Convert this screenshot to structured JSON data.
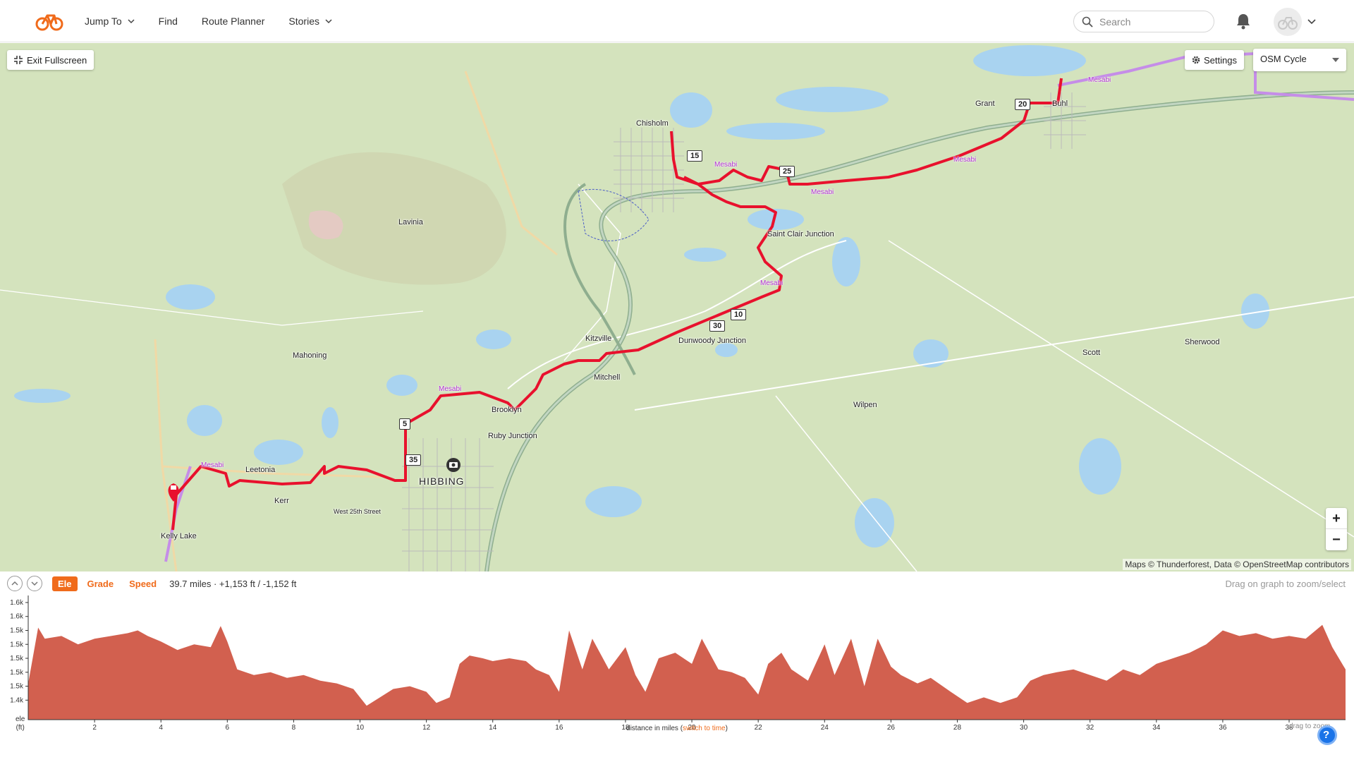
{
  "header": {
    "nav": [
      {
        "label": "Jump To",
        "has_menu": true
      },
      {
        "label": "Find",
        "has_menu": false
      },
      {
        "label": "Route Planner",
        "has_menu": false
      },
      {
        "label": "Stories",
        "has_menu": true
      }
    ],
    "search_placeholder": "Search",
    "brand_color": "#f06b1b"
  },
  "map": {
    "exit_fullscreen_label": "Exit Fullscreen",
    "settings_label": "Settings",
    "layer_selected": "OSM Cycle",
    "zoom_in": "+",
    "zoom_out": "−",
    "attribution": "Maps © Thunderforest, Data © OpenStreetMap contributors",
    "route_color": "#e8112d",
    "places": [
      "Chisholm",
      "Grant",
      "Buhl",
      "Lavinia",
      "Saint Clair Junction",
      "Kitzville",
      "Dunwoody Junction",
      "Mahoning",
      "Mitchell",
      "Scott",
      "Sherwood",
      "Wilpen",
      "Brooklyn",
      "Ruby Junction",
      "HIBBING",
      "Leetonia",
      "Kerr",
      "Kelly Lake",
      "West 25th Street"
    ],
    "trail_label": "Mesabi",
    "mile_markers": [
      "5",
      "10",
      "15",
      "20",
      "25",
      "30",
      "35"
    ]
  },
  "elevation_panel": {
    "tabs": [
      "Ele",
      "Grade",
      "Speed"
    ],
    "active_tab": "Ele",
    "stats": "39.7 miles · +1,153 ft / -1,152 ft",
    "hint": "Drag on graph to zoom/select",
    "y_unit": "ele\n(ft)",
    "x_caption_prefix": "distance in miles (",
    "x_caption_link": "switch to time",
    "x_caption_suffix": ")",
    "drag_to_zoom": "drag to zoom"
  },
  "chart_data": {
    "type": "area",
    "title": "",
    "xlabel": "distance in miles",
    "ylabel": "ele (ft)",
    "xlim": [
      0,
      39.7
    ],
    "ylim": [
      1390,
      1605
    ],
    "x_ticks": [
      2,
      4,
      6,
      8,
      10,
      12,
      14,
      16,
      18,
      20,
      22,
      24,
      26,
      28,
      30,
      32,
      34,
      36,
      38
    ],
    "y_tick_labels": [
      "1.6k",
      "1.6k",
      "1.5k",
      "1.5k",
      "1.5k",
      "1.5k",
      "1.5k",
      "1.4k"
    ],
    "y_tick_values": [
      1600,
      1575,
      1550,
      1525,
      1500,
      1475,
      1450,
      1425
    ],
    "fill_color": "#d2604f",
    "x": [
      0,
      0.3,
      0.5,
      1,
      1.5,
      2,
      2.5,
      3,
      3.3,
      3.6,
      4,
      4.5,
      5,
      5.5,
      5.8,
      6,
      6.3,
      6.8,
      7.3,
      7.8,
      8.3,
      8.8,
      9.3,
      9.8,
      10.2,
      10.6,
      11,
      11.5,
      12,
      12.3,
      12.7,
      13,
      13.3,
      13.7,
      14,
      14.5,
      15,
      15.3,
      15.7,
      16,
      16.3,
      16.7,
      17,
      17.5,
      18,
      18.3,
      18.6,
      19,
      19.5,
      20,
      20.3,
      20.8,
      21.2,
      21.6,
      22,
      22.3,
      22.7,
      23,
      23.5,
      24,
      24.3,
      24.8,
      25.2,
      25.6,
      26,
      26.3,
      26.8,
      27.2,
      27.8,
      28.3,
      28.8,
      29.3,
      29.8,
      30.2,
      30.6,
      31,
      31.5,
      32,
      32.5,
      33,
      33.5,
      34,
      34.5,
      35,
      35.5,
      36,
      36.5,
      37,
      37.5,
      38,
      38.5,
      39,
      39.3,
      39.7
    ],
    "y": [
      1455,
      1555,
      1535,
      1540,
      1525,
      1535,
      1540,
      1545,
      1550,
      1540,
      1530,
      1515,
      1525,
      1520,
      1558,
      1530,
      1480,
      1470,
      1475,
      1465,
      1470,
      1460,
      1455,
      1445,
      1415,
      1430,
      1445,
      1450,
      1440,
      1420,
      1430,
      1490,
      1505,
      1500,
      1495,
      1500,
      1495,
      1480,
      1470,
      1440,
      1550,
      1480,
      1535,
      1480,
      1520,
      1470,
      1440,
      1500,
      1510,
      1490,
      1535,
      1480,
      1475,
      1465,
      1435,
      1490,
      1510,
      1480,
      1460,
      1525,
      1470,
      1535,
      1450,
      1535,
      1485,
      1470,
      1455,
      1465,
      1440,
      1420,
      1430,
      1420,
      1430,
      1460,
      1470,
      1475,
      1480,
      1470,
      1460,
      1480,
      1470,
      1490,
      1500,
      1510,
      1525,
      1550,
      1540,
      1545,
      1535,
      1540,
      1535,
      1560,
      1520,
      1480
    ]
  }
}
